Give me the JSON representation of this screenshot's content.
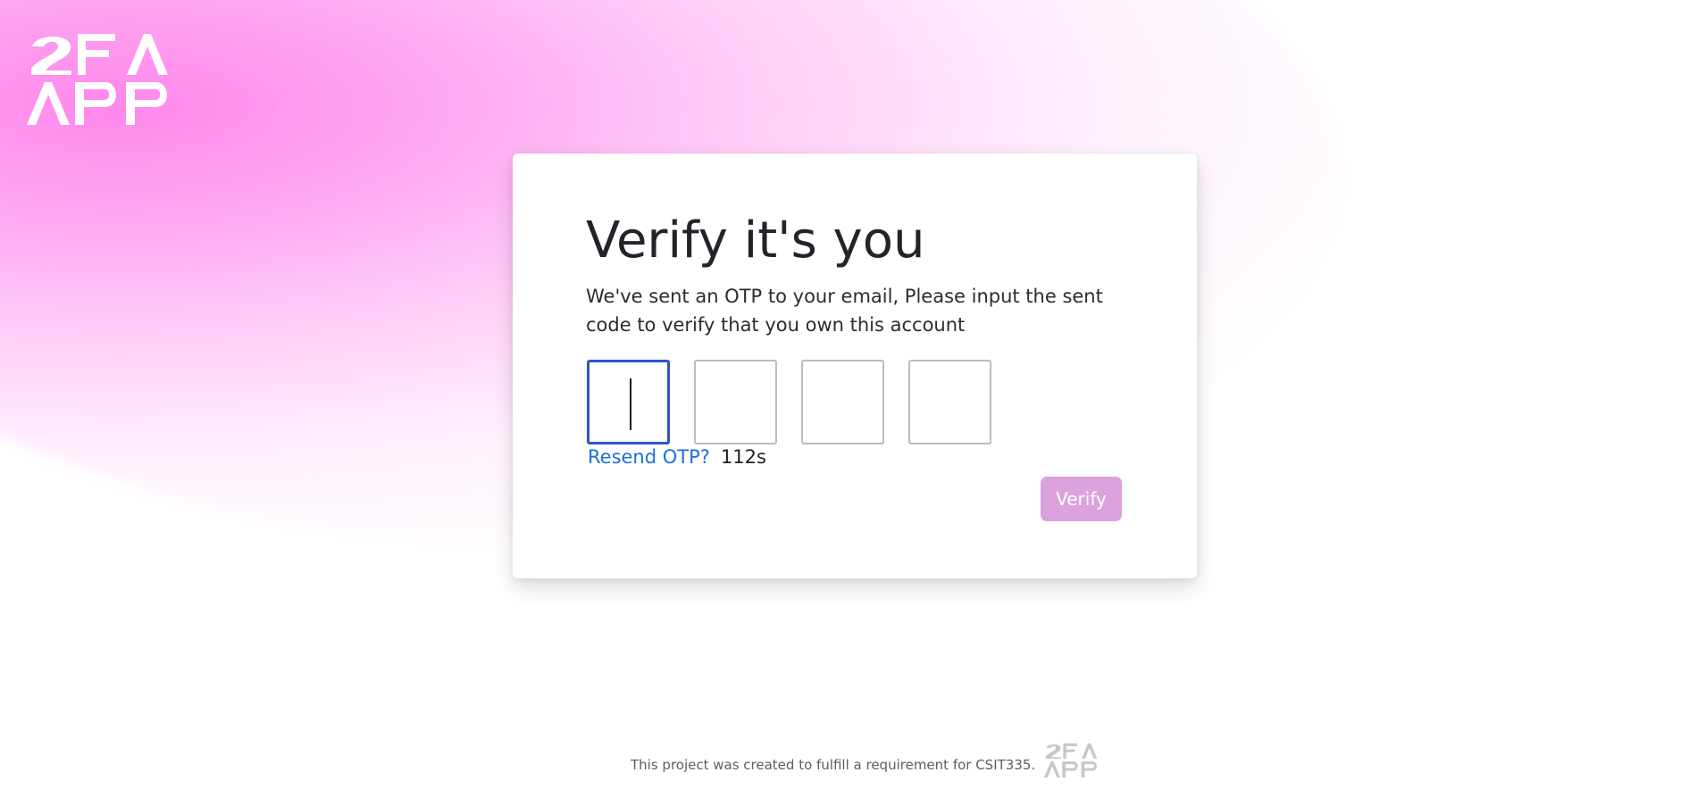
{
  "brand": {
    "logo_text": "2FA APP",
    "logo_color": "#ffffff",
    "footer_logo_color": "#c7c7c7"
  },
  "verification": {
    "title": "Verify it's you",
    "description": "We've sent an OTP to your email, Please input the sent code to verify that you own this account",
    "otp_digits": [
      "",
      "",
      "",
      ""
    ],
    "resend_label": "Resend OTP?",
    "countdown": "112s",
    "verify_label": "Verify"
  },
  "footer": {
    "text": "This project was created to fulfill a requirement for CSIT335."
  },
  "theme": {
    "accent_pink": "#ff8fe9",
    "link_blue": "#1c6fe0",
    "button_pink": "#dca2dd",
    "active_border": "#2b55c8"
  }
}
